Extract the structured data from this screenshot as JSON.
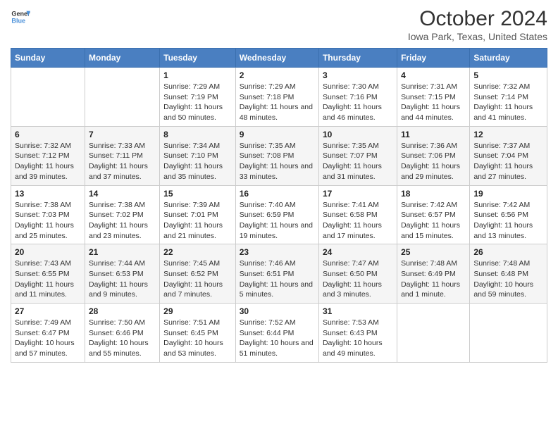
{
  "header": {
    "logo_line1": "General",
    "logo_line2": "Blue",
    "main_title": "October 2024",
    "subtitle": "Iowa Park, Texas, United States"
  },
  "days_of_week": [
    "Sunday",
    "Monday",
    "Tuesday",
    "Wednesday",
    "Thursday",
    "Friday",
    "Saturday"
  ],
  "weeks": [
    [
      {
        "day": "",
        "info": ""
      },
      {
        "day": "",
        "info": ""
      },
      {
        "day": "1",
        "info": "Sunrise: 7:29 AM\nSunset: 7:19 PM\nDaylight: 11 hours and 50 minutes."
      },
      {
        "day": "2",
        "info": "Sunrise: 7:29 AM\nSunset: 7:18 PM\nDaylight: 11 hours and 48 minutes."
      },
      {
        "day": "3",
        "info": "Sunrise: 7:30 AM\nSunset: 7:16 PM\nDaylight: 11 hours and 46 minutes."
      },
      {
        "day": "4",
        "info": "Sunrise: 7:31 AM\nSunset: 7:15 PM\nDaylight: 11 hours and 44 minutes."
      },
      {
        "day": "5",
        "info": "Sunrise: 7:32 AM\nSunset: 7:14 PM\nDaylight: 11 hours and 41 minutes."
      }
    ],
    [
      {
        "day": "6",
        "info": "Sunrise: 7:32 AM\nSunset: 7:12 PM\nDaylight: 11 hours and 39 minutes."
      },
      {
        "day": "7",
        "info": "Sunrise: 7:33 AM\nSunset: 7:11 PM\nDaylight: 11 hours and 37 minutes."
      },
      {
        "day": "8",
        "info": "Sunrise: 7:34 AM\nSunset: 7:10 PM\nDaylight: 11 hours and 35 minutes."
      },
      {
        "day": "9",
        "info": "Sunrise: 7:35 AM\nSunset: 7:08 PM\nDaylight: 11 hours and 33 minutes."
      },
      {
        "day": "10",
        "info": "Sunrise: 7:35 AM\nSunset: 7:07 PM\nDaylight: 11 hours and 31 minutes."
      },
      {
        "day": "11",
        "info": "Sunrise: 7:36 AM\nSunset: 7:06 PM\nDaylight: 11 hours and 29 minutes."
      },
      {
        "day": "12",
        "info": "Sunrise: 7:37 AM\nSunset: 7:04 PM\nDaylight: 11 hours and 27 minutes."
      }
    ],
    [
      {
        "day": "13",
        "info": "Sunrise: 7:38 AM\nSunset: 7:03 PM\nDaylight: 11 hours and 25 minutes."
      },
      {
        "day": "14",
        "info": "Sunrise: 7:38 AM\nSunset: 7:02 PM\nDaylight: 11 hours and 23 minutes."
      },
      {
        "day": "15",
        "info": "Sunrise: 7:39 AM\nSunset: 7:01 PM\nDaylight: 11 hours and 21 minutes."
      },
      {
        "day": "16",
        "info": "Sunrise: 7:40 AM\nSunset: 6:59 PM\nDaylight: 11 hours and 19 minutes."
      },
      {
        "day": "17",
        "info": "Sunrise: 7:41 AM\nSunset: 6:58 PM\nDaylight: 11 hours and 17 minutes."
      },
      {
        "day": "18",
        "info": "Sunrise: 7:42 AM\nSunset: 6:57 PM\nDaylight: 11 hours and 15 minutes."
      },
      {
        "day": "19",
        "info": "Sunrise: 7:42 AM\nSunset: 6:56 PM\nDaylight: 11 hours and 13 minutes."
      }
    ],
    [
      {
        "day": "20",
        "info": "Sunrise: 7:43 AM\nSunset: 6:55 PM\nDaylight: 11 hours and 11 minutes."
      },
      {
        "day": "21",
        "info": "Sunrise: 7:44 AM\nSunset: 6:53 PM\nDaylight: 11 hours and 9 minutes."
      },
      {
        "day": "22",
        "info": "Sunrise: 7:45 AM\nSunset: 6:52 PM\nDaylight: 11 hours and 7 minutes."
      },
      {
        "day": "23",
        "info": "Sunrise: 7:46 AM\nSunset: 6:51 PM\nDaylight: 11 hours and 5 minutes."
      },
      {
        "day": "24",
        "info": "Sunrise: 7:47 AM\nSunset: 6:50 PM\nDaylight: 11 hours and 3 minutes."
      },
      {
        "day": "25",
        "info": "Sunrise: 7:48 AM\nSunset: 6:49 PM\nDaylight: 11 hours and 1 minute."
      },
      {
        "day": "26",
        "info": "Sunrise: 7:48 AM\nSunset: 6:48 PM\nDaylight: 10 hours and 59 minutes."
      }
    ],
    [
      {
        "day": "27",
        "info": "Sunrise: 7:49 AM\nSunset: 6:47 PM\nDaylight: 10 hours and 57 minutes."
      },
      {
        "day": "28",
        "info": "Sunrise: 7:50 AM\nSunset: 6:46 PM\nDaylight: 10 hours and 55 minutes."
      },
      {
        "day": "29",
        "info": "Sunrise: 7:51 AM\nSunset: 6:45 PM\nDaylight: 10 hours and 53 minutes."
      },
      {
        "day": "30",
        "info": "Sunrise: 7:52 AM\nSunset: 6:44 PM\nDaylight: 10 hours and 51 minutes."
      },
      {
        "day": "31",
        "info": "Sunrise: 7:53 AM\nSunset: 6:43 PM\nDaylight: 10 hours and 49 minutes."
      },
      {
        "day": "",
        "info": ""
      },
      {
        "day": "",
        "info": ""
      }
    ]
  ]
}
